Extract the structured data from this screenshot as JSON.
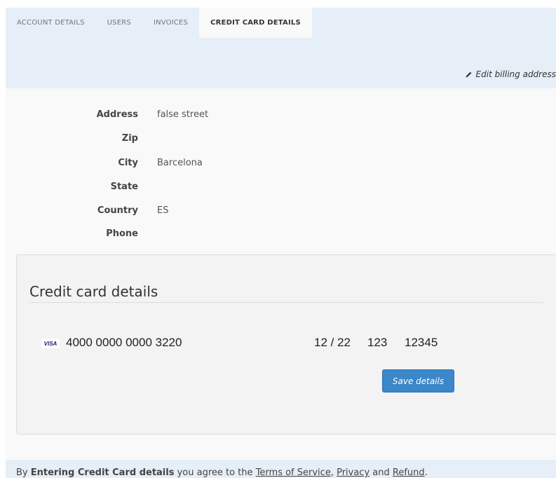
{
  "tabs": [
    {
      "label": "ACCOUNT DETAILS",
      "active": false
    },
    {
      "label": "USERS",
      "active": false
    },
    {
      "label": "INVOICES",
      "active": false
    },
    {
      "label": "CREDIT CARD DETAILS",
      "active": true
    }
  ],
  "header": {
    "edit_link": "Edit billing address",
    "edit_icon": "pencil-icon"
  },
  "address": {
    "rows": [
      {
        "label": "Address",
        "value": "false street"
      },
      {
        "label": "Zip",
        "value": ""
      },
      {
        "label": "City",
        "value": "Barcelona"
      },
      {
        "label": "State",
        "value": ""
      },
      {
        "label": "Country",
        "value": "ES"
      },
      {
        "label": "Phone",
        "value": ""
      }
    ]
  },
  "card": {
    "title": "Credit card details",
    "brand": "VISA",
    "number": "4000 0000 0000 3220",
    "expiry": "12 / 22",
    "cvc": "123",
    "zip": "12345",
    "save_label": "Save details"
  },
  "footer": {
    "prefix": "By ",
    "bold": "Entering Credit Card details",
    "middle": " you agree to the ",
    "terms": "Terms of Service",
    "comma": ", ",
    "privacy": "Privacy",
    "and": " and ",
    "refund": "Refund",
    "period": "."
  },
  "colors": {
    "accent": "#3a87c9",
    "band": "#e6eef7",
    "panel": "#f9f9f9"
  }
}
